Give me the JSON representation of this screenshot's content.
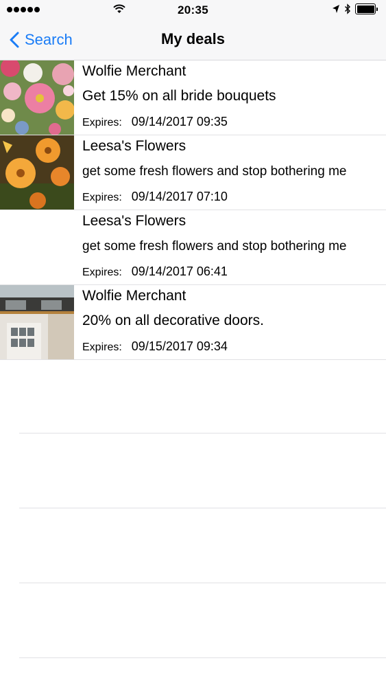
{
  "status_bar": {
    "time": "20:35",
    "icons": [
      "signal-dots-icon",
      "wifi-icon",
      "location-arrow-icon",
      "bluetooth-icon",
      "battery-icon"
    ]
  },
  "nav": {
    "back_label": "Search",
    "title": "My deals"
  },
  "colors": {
    "accent": "#1a7cf6",
    "bar_background": "#f7f7f8",
    "separator": "#e1e1e4"
  },
  "deals": [
    {
      "merchant": "Wolfie Merchant",
      "description": "Get 15% on all bride bouquets",
      "expires_label": "Expires:",
      "expires": "09/14/2017 09:35",
      "image": "flower-bouquet-photo"
    },
    {
      "merchant": "Leesa's Flowers",
      "description": "get some fresh flowers and stop bothering me",
      "expires_label": "Expires:",
      "expires": "09/14/2017 07:10",
      "image": "orange-flowers-photo"
    },
    {
      "merchant": "Leesa's Flowers",
      "description": "get some fresh flowers and stop bothering me",
      "expires_label": "Expires:",
      "expires": "09/14/2017 06:41",
      "image": ""
    },
    {
      "merchant": "Wolfie Merchant",
      "description": "20% on all decorative doors.",
      "expires_label": "Expires:",
      "expires": "09/15/2017 09:34",
      "image": "room-doors-photo"
    }
  ]
}
